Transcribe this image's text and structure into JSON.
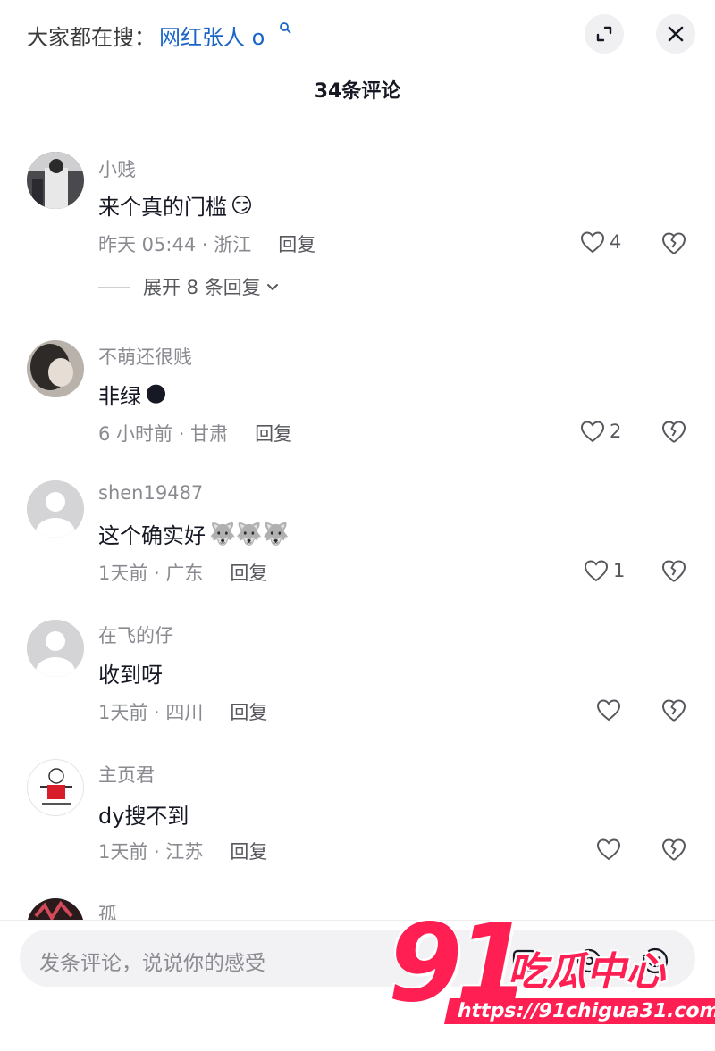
{
  "header": {
    "search_prefix": "大家都在搜：",
    "search_term": "网红张人 o",
    "comment_count": "34条评论"
  },
  "comments": [
    {
      "username": "小贱",
      "text": "来个真的门槛",
      "emoji": "😏",
      "time_location": "昨天 05:44 · 浙江",
      "reply_label": "回复",
      "likes": "4",
      "expand_label": "展开 8 条回复"
    },
    {
      "username": "不萌还很贱",
      "text": "非绿",
      "emoji": "🌑",
      "time_location": "6 小时前 · 甘肃",
      "reply_label": "回复",
      "likes": "2"
    },
    {
      "username": "shen19487",
      "text": "这个确实好",
      "emoji": "🐺🐺🐺",
      "time_location": "1天前 · 广东",
      "reply_label": "回复",
      "likes": "1"
    },
    {
      "username": "在飞的仔",
      "text": "收到呀",
      "time_location": "1天前 · 四川",
      "reply_label": "回复",
      "likes": ""
    },
    {
      "username": "主页君",
      "text": "dy搜不到",
      "time_location": "1天前 · 江苏",
      "reply_label": "回复",
      "likes": ""
    },
    {
      "username": "孤"
    }
  ],
  "input": {
    "placeholder": "发条评论，说说你的感受"
  },
  "watermark": {
    "number": "91",
    "title": "吃瓜中心",
    "url": "https://91chigua31.com"
  },
  "colors": {
    "search_term": "#1a64c8",
    "watermark": "#ff1f52",
    "meta": "#8a8b91"
  }
}
